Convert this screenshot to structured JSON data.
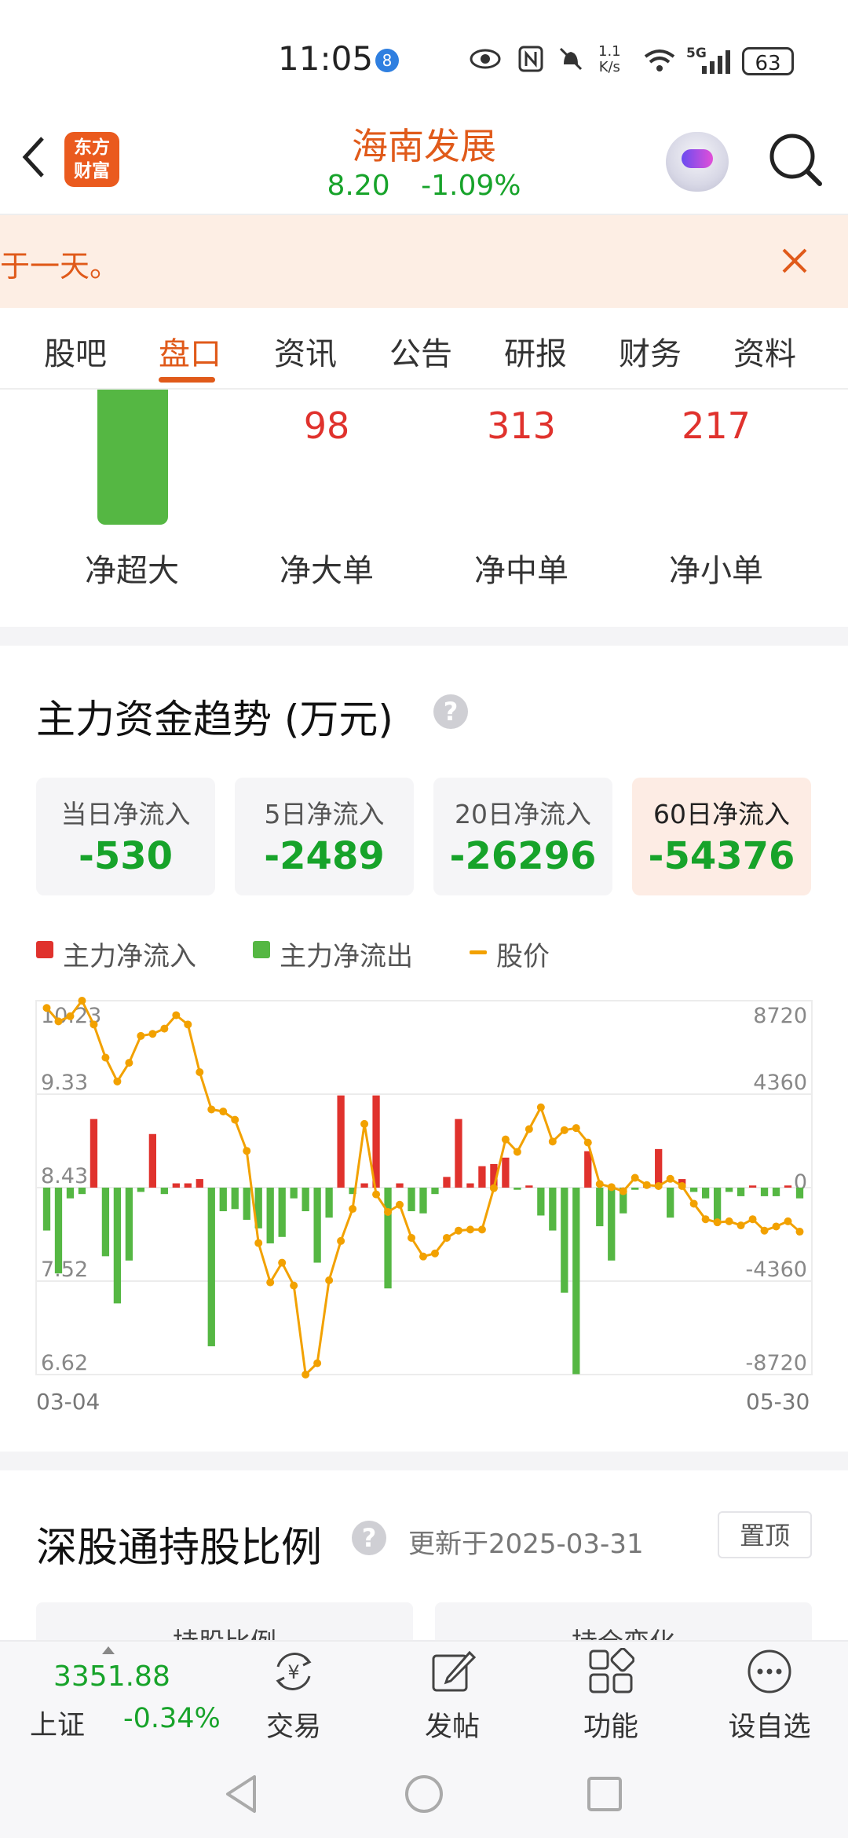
{
  "status_bar": {
    "time": "11:05",
    "notif_badge": "8",
    "net_speed_top": "1.1",
    "net_speed_bottom": "K/s",
    "network": "5G",
    "battery": "63"
  },
  "header": {
    "logo_line1": "东方",
    "logo_line2": "财富",
    "stock_name": "海南发展",
    "price": "8.20",
    "change_pct": "-1.09%"
  },
  "banner": {
    "text": "于一天。",
    "close_icon": "close-icon"
  },
  "tabs": [
    "股吧",
    "盘口",
    "资讯",
    "公告",
    "研报",
    "财务",
    "资料"
  ],
  "active_tab": "盘口",
  "flows": [
    {
      "label": "净超大",
      "value": ""
    },
    {
      "label": "净大单",
      "value": "98"
    },
    {
      "label": "净中单",
      "value": "313"
    },
    {
      "label": "净小单",
      "value": "217"
    }
  ],
  "trend": {
    "title": "主力资金趋势 (万元)",
    "help": "?",
    "cards": [
      {
        "label": "当日净流入",
        "value": "-530"
      },
      {
        "label": "5日净流入",
        "value": "-2489"
      },
      {
        "label": "20日净流入",
        "value": "-26296"
      },
      {
        "label": "60日净流入",
        "value": "-54376"
      }
    ],
    "legend": {
      "inflow": "主力净流入",
      "outflow": "主力净流出",
      "price": "股价"
    },
    "date_start": "03-04",
    "date_end": "05-30"
  },
  "chart_data": {
    "type": "bar",
    "title": "",
    "price_ticks": [
      "10.23",
      "9.33",
      "8.43",
      "7.52",
      "6.62"
    ],
    "flow_ticks": [
      "8720",
      "4360",
      "0",
      "-4360",
      "-8720"
    ],
    "price_range": [
      6.62,
      10.23
    ],
    "flow_range": [
      -8720,
      8720
    ],
    "net_flow": [
      -2000,
      -4000,
      -500,
      -300,
      3200,
      -3200,
      -5400,
      -3400,
      -200,
      2500,
      -300,
      200,
      200,
      400,
      -7400,
      -1100,
      -1000,
      -1500,
      -1900,
      -2600,
      -2300,
      -500,
      -1100,
      -3500,
      -1400,
      4300,
      -300,
      200,
      4300,
      -4700,
      200,
      -1100,
      -1200,
      -300,
      500,
      3200,
      200,
      1000,
      1100,
      1400,
      -100,
      100,
      -1300,
      -2000,
      -4900,
      -8700,
      1700,
      -1800,
      -3400,
      -1200,
      -100,
      200,
      1800,
      -1400,
      400,
      -200,
      -500,
      -1700,
      -200,
      -400,
      100,
      -400,
      -400,
      100,
      -500
    ],
    "price": [
      10.16,
      10.03,
      10.08,
      10.23,
      10.0,
      9.68,
      9.45,
      9.63,
      9.89,
      9.91,
      9.96,
      10.09,
      10.0,
      9.54,
      9.18,
      9.16,
      9.08,
      8.78,
      7.89,
      7.51,
      7.7,
      7.48,
      6.62,
      6.73,
      7.53,
      7.91,
      8.22,
      9.04,
      8.36,
      8.19,
      8.26,
      7.94,
      7.76,
      7.79,
      7.94,
      8.01,
      8.02,
      8.02,
      8.42,
      8.89,
      8.77,
      8.99,
      9.2,
      8.87,
      8.98,
      9.0,
      8.86,
      8.46,
      8.43,
      8.39,
      8.52,
      8.45,
      8.44,
      8.51,
      8.44,
      8.27,
      8.12,
      8.09,
      8.1,
      8.06,
      8.12,
      8.01,
      8.05,
      8.1,
      8.0
    ]
  },
  "hk_holding": {
    "title": "深股通持股比例",
    "help": "?",
    "updated": "更新于2025-03-31",
    "pin": "置顶",
    "sub_tabs": [
      "持股比例",
      "持仓变化"
    ]
  },
  "bottom_nav": {
    "index_value": "3351.88",
    "index_name": "上证",
    "index_change": "-0.34%",
    "items": [
      {
        "label": "交易",
        "icon": "yen-cycle-icon"
      },
      {
        "label": "发帖",
        "icon": "edit-icon"
      },
      {
        "label": "功能",
        "icon": "grid-icon"
      },
      {
        "label": "设自选",
        "icon": "more-icon"
      }
    ]
  },
  "colors": {
    "accent": "#e05a1a",
    "up": "#e0322d",
    "down": "#17a32a",
    "bar_down": "#55b743",
    "price_line": "#f2a100"
  }
}
